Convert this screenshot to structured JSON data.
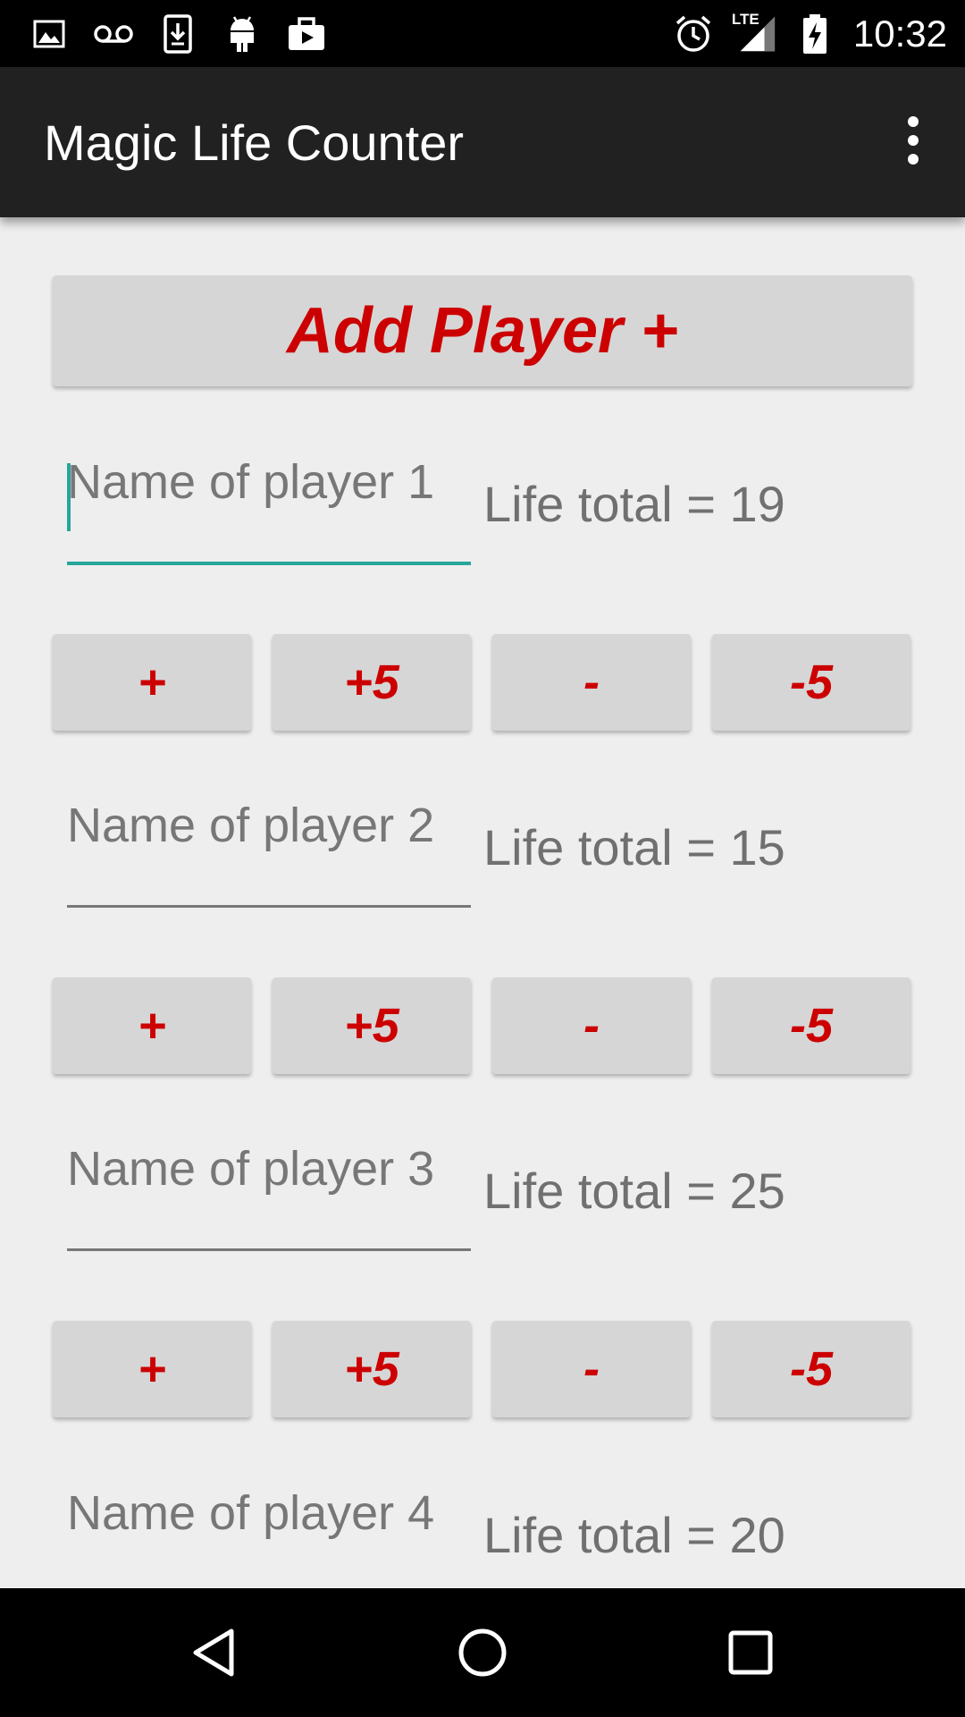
{
  "status_bar": {
    "time": "10:32",
    "left_icons": [
      "image-icon",
      "voicemail-icon",
      "download-icon",
      "android-icon",
      "briefcase-play-icon"
    ],
    "right_icons": [
      "alarm-icon",
      "lte-signal-icon",
      "battery-charging-icon"
    ],
    "network_label": "LTE"
  },
  "app_bar": {
    "title": "Magic Life Counter",
    "overflow_icon": "more-vert-icon"
  },
  "add_player_label": "Add Player +",
  "players": [
    {
      "placeholder": "Name of player 1",
      "life_text": "Life total = 19",
      "focused": true
    },
    {
      "placeholder": "Name of player 2",
      "life_text": "Life total = 15"
    },
    {
      "placeholder": "Name of player 3",
      "life_text": "Life total = 25"
    },
    {
      "placeholder": "Name of player 4",
      "life_text": "Life total = 20"
    }
  ],
  "buttons": {
    "plus": "+",
    "plus5": "+5",
    "minus": "-",
    "minus5": "-5"
  },
  "colors": {
    "accent_red": "#cc0000",
    "focus_teal": "#26a69a",
    "app_bar": "#212121",
    "background": "#eeeeee",
    "button_bg": "#d6d6d6"
  },
  "nav_bar": {
    "icons": [
      "back-icon",
      "home-icon",
      "recents-icon"
    ]
  }
}
